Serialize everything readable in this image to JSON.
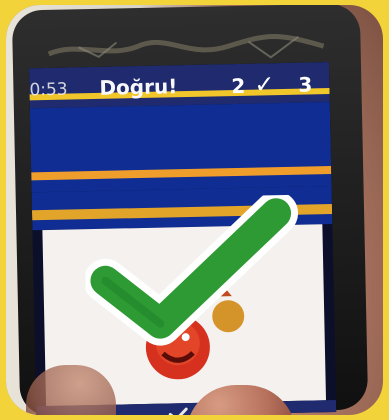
{
  "topbar": {
    "time": "0:53",
    "title": "Doğru!",
    "score_left": "2",
    "score_right": "3"
  },
  "icons": {
    "big_check": "check-icon",
    "score_check": "check-icon",
    "small_check": "check-icon"
  },
  "colors": {
    "topbar_blue": "#1f2b6e",
    "panel_blue": "#0f2d93",
    "accent_yellow": "#f0c62a",
    "check_green": "#2d9a33"
  }
}
